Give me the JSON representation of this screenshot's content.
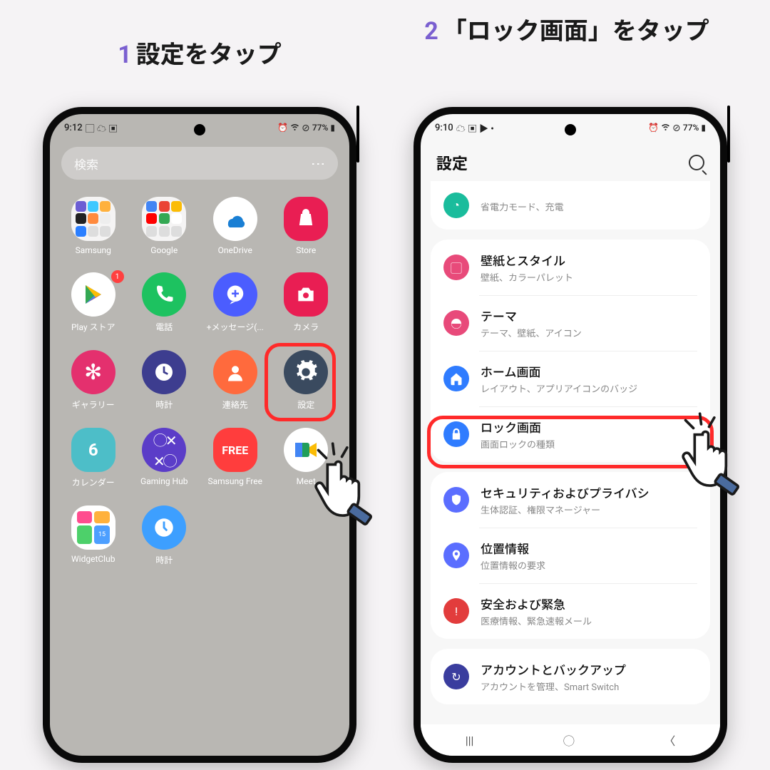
{
  "steps": {
    "1": {
      "num": "1",
      "text": "設定をタップ"
    },
    "2": {
      "num": "2",
      "text": "「ロック画面」をタップ"
    }
  },
  "status": {
    "time1": "9:12",
    "time2": "9:10",
    "battery": "77%"
  },
  "phone1": {
    "search_placeholder": "検索",
    "apps": [
      {
        "label": "Samsung"
      },
      {
        "label": "Google"
      },
      {
        "label": "OneDrive"
      },
      {
        "label": "Store"
      },
      {
        "label": "Play ストア"
      },
      {
        "label": "電話"
      },
      {
        "label": "+メッセージ(..."
      },
      {
        "label": "カメラ"
      },
      {
        "label": "ギャラリー"
      },
      {
        "label": "時計"
      },
      {
        "label": "連絡先"
      },
      {
        "label": "設定"
      },
      {
        "label": "カレンダー"
      },
      {
        "label": "Gaming Hub"
      },
      {
        "label": "Samsung Free"
      },
      {
        "label": "Meet"
      },
      {
        "label": "WidgetClub"
      },
      {
        "label": "時計"
      }
    ],
    "badge1": "1"
  },
  "phone2": {
    "header": "設定",
    "items": [
      {
        "title": "",
        "sub": "省電力モード、充電",
        "color": "#1abc9c",
        "icon": "battery"
      },
      {
        "title": "壁紙とスタイル",
        "sub": "壁紙、カラーパレット",
        "color": "#e84a7a",
        "icon": "wallpaper"
      },
      {
        "title": "テーマ",
        "sub": "テーマ、壁紙、アイコン",
        "color": "#e84a7a",
        "icon": "theme"
      },
      {
        "title": "ホーム画面",
        "sub": "レイアウト、アプリアイコンのバッジ",
        "color": "#2f7cff",
        "icon": "home"
      },
      {
        "title": "ロック画面",
        "sub": "画面ロックの種類",
        "color": "#2f7cff",
        "icon": "lock"
      },
      {
        "title": "セキュリティおよびプライバシ",
        "sub": "生体認証、権限マネージャー",
        "color": "#5b6eff",
        "icon": "shield"
      },
      {
        "title": "位置情報",
        "sub": "位置情報の要求",
        "color": "#5b6eff",
        "icon": "location"
      },
      {
        "title": "安全および緊急",
        "sub": "医療情報、緊急速報メール",
        "color": "#e23c3c",
        "icon": "emergency"
      },
      {
        "title": "アカウントとバックアップ",
        "sub": "アカウントを管理、Smart Switch",
        "color": "#3a3d9e",
        "icon": "sync"
      }
    ]
  }
}
